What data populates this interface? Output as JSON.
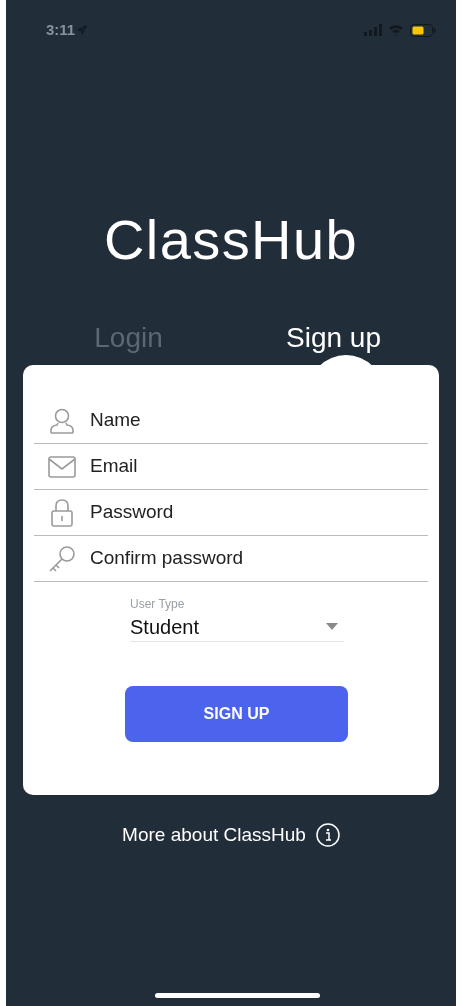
{
  "status_bar": {
    "time": "3:11"
  },
  "app_title": "ClassHub",
  "tabs": [
    {
      "label": "Login",
      "selected": false
    },
    {
      "label": "Sign up",
      "selected": true
    }
  ],
  "fields": [
    {
      "kind": "name",
      "placeholder": "Name"
    },
    {
      "kind": "email",
      "placeholder": "Email"
    },
    {
      "kind": "password",
      "placeholder": "Password"
    },
    {
      "kind": "confirm",
      "placeholder": "Confirm password"
    }
  ],
  "user_type": {
    "label": "User Type",
    "value": "Student"
  },
  "submit_button": "SIGN UP",
  "footer_link": "More about ClassHub"
}
